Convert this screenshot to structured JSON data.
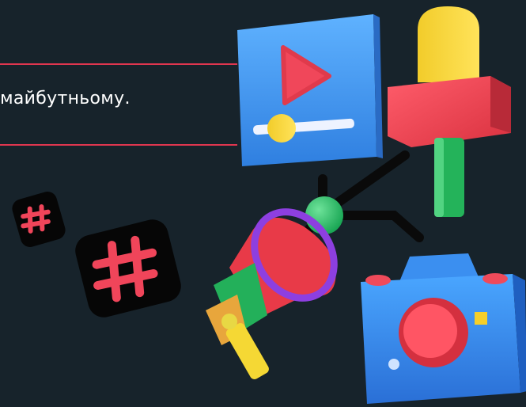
{
  "caption": {
    "text": "майбутньому."
  },
  "colors": {
    "background": "#17232b",
    "accent_line": "#e0364f",
    "caption_text": "#ffffff"
  },
  "icons": [
    "hashtag-tile-icon",
    "video-player-icon",
    "microphone-icon",
    "megaphone-icon",
    "camera-icon",
    "tripod-arm-icon"
  ]
}
